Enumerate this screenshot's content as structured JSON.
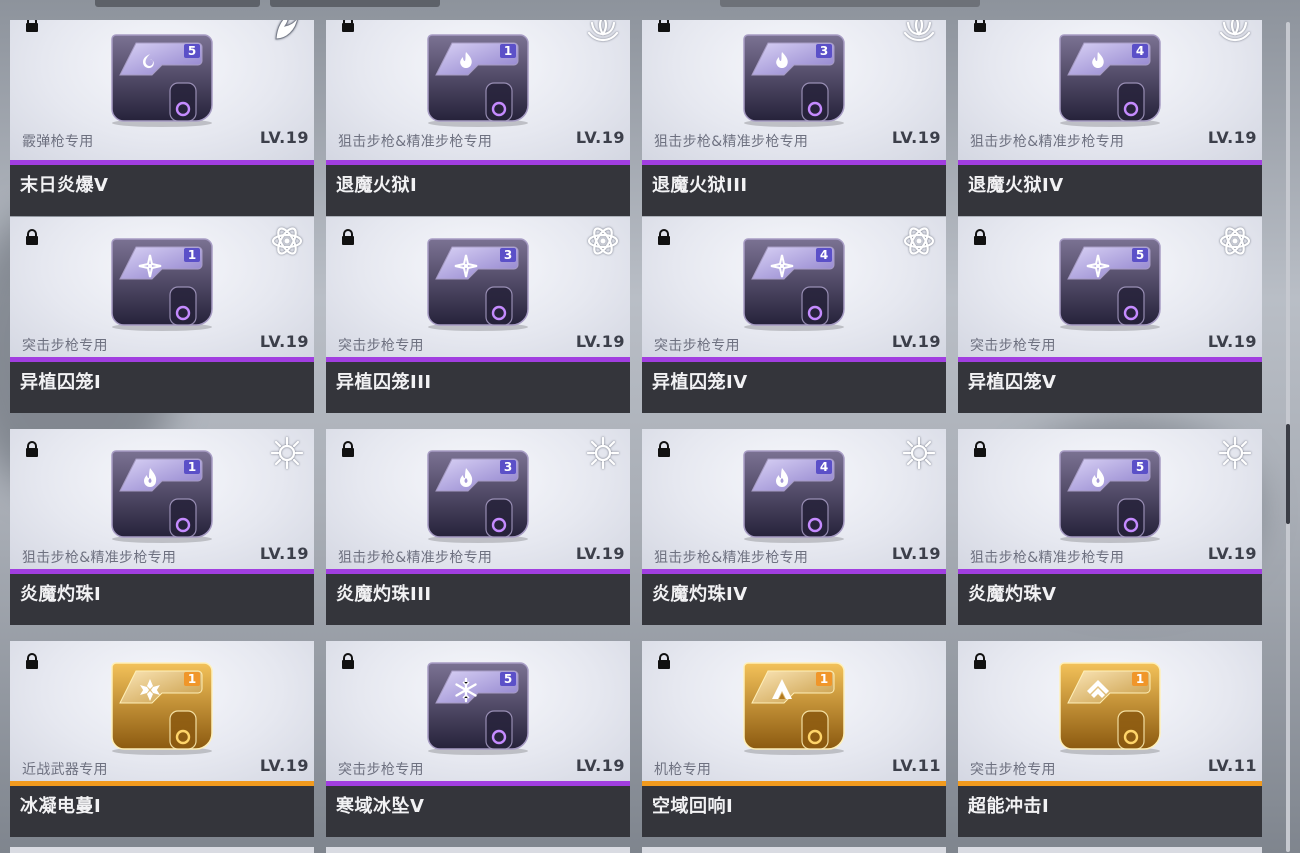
{
  "scroll_position": 0.55,
  "chips": [
    {
      "name": "末日炎爆V",
      "restriction": "霰弹枪专用",
      "level": "LV.19",
      "tier": "5",
      "rarity": "purple",
      "element": "fire",
      "emblem": "flame-swirl-icon"
    },
    {
      "name": "退魔火狱I",
      "restriction": "狙击步枪&精准步枪专用",
      "level": "LV.19",
      "tier": "1",
      "rarity": "purple",
      "element": "lotus",
      "emblem": "flame-icon"
    },
    {
      "name": "退魔火狱III",
      "restriction": "狙击步枪&精准步枪专用",
      "level": "LV.19",
      "tier": "3",
      "rarity": "purple",
      "element": "lotus",
      "emblem": "flame-icon"
    },
    {
      "name": "退魔火狱IV",
      "restriction": "狙击步枪&精准步枪专用",
      "level": "LV.19",
      "tier": "4",
      "rarity": "purple",
      "element": "lotus",
      "emblem": "flame-icon"
    },
    {
      "name": "异植囚笼I",
      "restriction": "突击步枪专用",
      "level": "LV.19",
      "tier": "1",
      "rarity": "purple",
      "element": "atom",
      "emblem": "shuriken-icon"
    },
    {
      "name": "异植囚笼III",
      "restriction": "突击步枪专用",
      "level": "LV.19",
      "tier": "3",
      "rarity": "purple",
      "element": "atom",
      "emblem": "shuriken-icon"
    },
    {
      "name": "异植囚笼IV",
      "restriction": "突击步枪专用",
      "level": "LV.19",
      "tier": "4",
      "rarity": "purple",
      "element": "atom",
      "emblem": "shuriken-icon"
    },
    {
      "name": "异植囚笼V",
      "restriction": "突击步枪专用",
      "level": "LV.19",
      "tier": "5",
      "rarity": "purple",
      "element": "atom",
      "emblem": "shuriken-icon"
    },
    {
      "name": "炎魔灼珠I",
      "restriction": "狙击步枪&精准步枪专用",
      "level": "LV.19",
      "tier": "1",
      "rarity": "purple",
      "element": "sunburst",
      "emblem": "fire-drop-icon"
    },
    {
      "name": "炎魔灼珠III",
      "restriction": "狙击步枪&精准步枪专用",
      "level": "LV.19",
      "tier": "3",
      "rarity": "purple",
      "element": "sunburst",
      "emblem": "fire-drop-icon"
    },
    {
      "name": "炎魔灼珠IV",
      "restriction": "狙击步枪&精准步枪专用",
      "level": "LV.19",
      "tier": "4",
      "rarity": "purple",
      "element": "sunburst",
      "emblem": "fire-drop-icon"
    },
    {
      "name": "炎魔灼珠V",
      "restriction": "狙击步枪&精准步枪专用",
      "level": "LV.19",
      "tier": "5",
      "rarity": "purple",
      "element": "sunburst",
      "emblem": "fire-drop-icon"
    },
    {
      "name": "冰凝电蔓I",
      "restriction": "近战武器专用",
      "level": "LV.19",
      "tier": "1",
      "rarity": "orange",
      "element": "none",
      "emblem": "crystal-flower-icon"
    },
    {
      "name": "寒域冰坠V",
      "restriction": "突击步枪专用",
      "level": "LV.19",
      "tier": "5",
      "rarity": "purple",
      "element": "none",
      "emblem": "snowflake-icon"
    },
    {
      "name": "空域回响I",
      "restriction": "机枪专用",
      "level": "LV.11",
      "tier": "1",
      "rarity": "orange",
      "element": "none",
      "emblem": "peak-icon"
    },
    {
      "name": "超能冲击I",
      "restriction": "突击步枪专用",
      "level": "LV.11",
      "tier": "1",
      "rarity": "orange",
      "element": "none",
      "emblem": "chevron-up-icon"
    }
  ],
  "colors": {
    "purple_rarity": "#a13ee0",
    "orange_rarity": "#f19a1e",
    "name_bar": "#34353b"
  }
}
